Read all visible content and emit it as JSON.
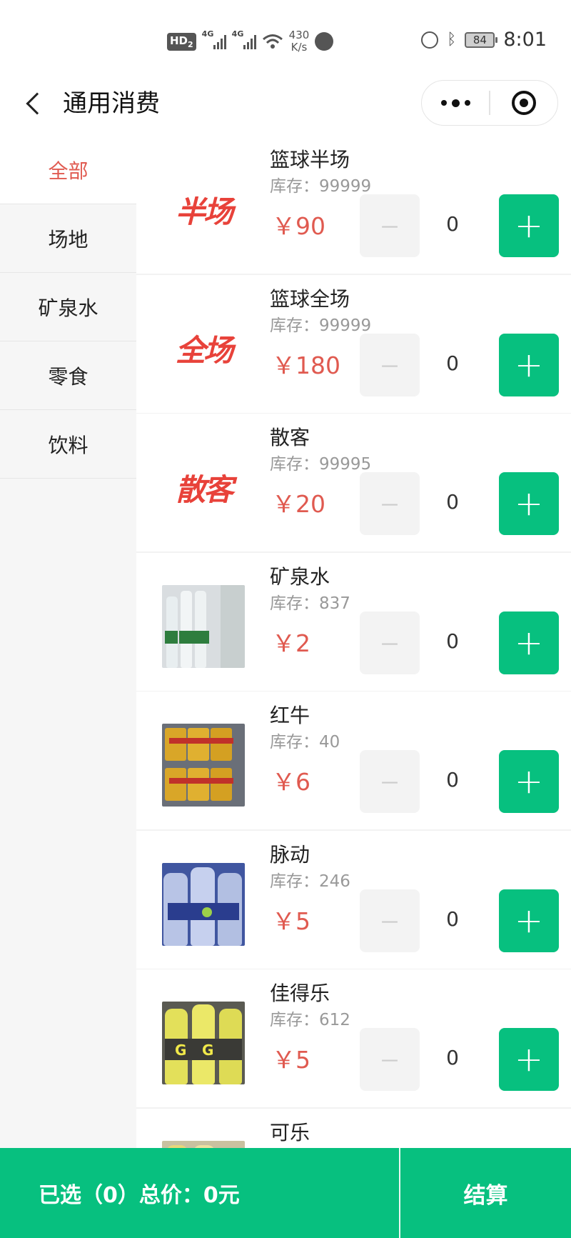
{
  "status_bar": {
    "hd": "HD",
    "hd_sub": "2",
    "sig1": "4G",
    "sig2": "4G",
    "speed_line1": "430",
    "speed_line2": "K/s",
    "battery": "84",
    "time": "8:01"
  },
  "nav": {
    "title": "通用消费"
  },
  "categories": [
    {
      "label": "全部",
      "active": true
    },
    {
      "label": "场地",
      "active": false
    },
    {
      "label": "矿泉水",
      "active": false
    },
    {
      "label": "零食",
      "active": false
    },
    {
      "label": "饮料",
      "active": false
    }
  ],
  "products": [
    {
      "name": "篮球半场",
      "stock": "库存：99999",
      "price": "￥90",
      "qty": "0",
      "thumb_text": "半场",
      "minus": "－",
      "plus": "+"
    },
    {
      "name": "篮球全场",
      "stock": "库存：99999",
      "price": "￥180",
      "qty": "0",
      "thumb_text": "全场",
      "minus": "－",
      "plus": "+"
    },
    {
      "name": "散客",
      "stock": "库存：99995",
      "price": "￥20",
      "qty": "0",
      "thumb_text": "散客",
      "minus": "－",
      "plus": "+"
    },
    {
      "name": "矿泉水",
      "stock": "库存：837",
      "price": "￥2",
      "qty": "0",
      "minus": "－",
      "plus": "+"
    },
    {
      "name": "红牛",
      "stock": "库存：40",
      "price": "￥6",
      "qty": "0",
      "minus": "－",
      "plus": "+"
    },
    {
      "name": "脉动",
      "stock": "库存：246",
      "price": "￥5",
      "qty": "0",
      "minus": "－",
      "plus": "+"
    },
    {
      "name": "佳得乐",
      "stock": "库存：612",
      "price": "￥5",
      "qty": "0",
      "minus": "－",
      "plus": "+"
    },
    {
      "name": "可乐"
    }
  ],
  "bottom": {
    "summary": "已选（0）总价：0元",
    "checkout": "结算"
  },
  "colors": {
    "accent_green": "#07c07f",
    "price_red": "#e05a50",
    "active_category": "#e05a50"
  }
}
